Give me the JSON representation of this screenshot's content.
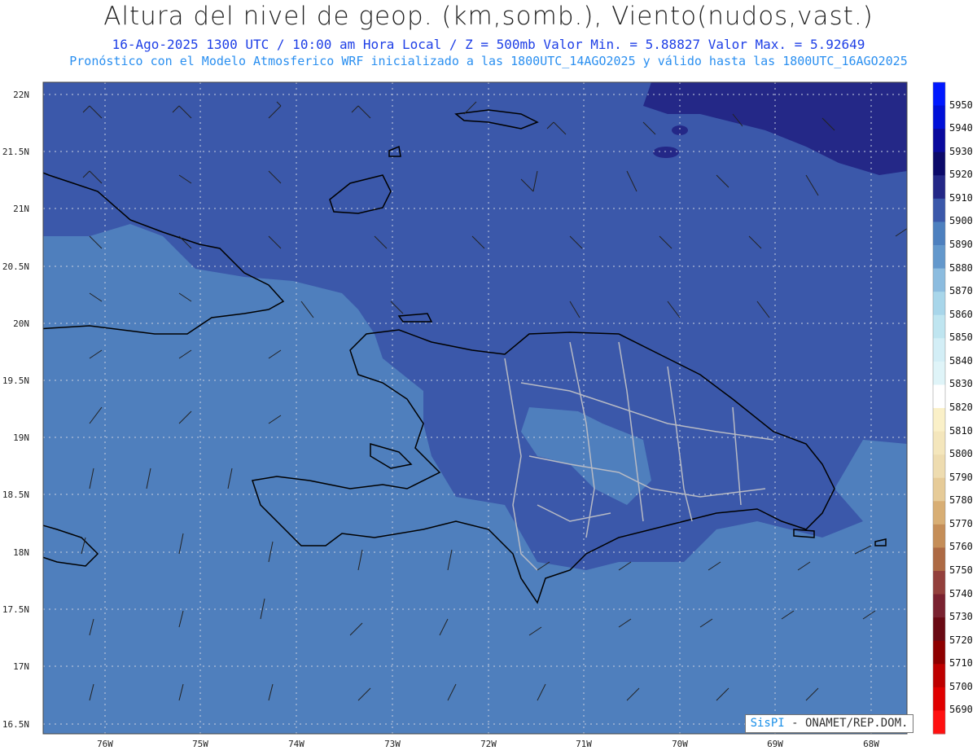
{
  "header": {
    "title": "Altura del nivel de geop. (km,somb.), Viento(nudos,vast.)",
    "subtitle": "16-Ago-2025  1300 UTC / 10:00 am Hora Local / Z = 500mb    Valor Min. = 5.88827  Valor Max. = 5.92649",
    "forecast_note": "Pronóstico con el Modelo Atmosferico WRF inicializado a las 1800UTC_14AGO2025 y válido hasta las  1800UTC_16AGO2025"
  },
  "axes": {
    "lat_labels": [
      "22N",
      "21.5N",
      "21N",
      "20.5N",
      "20N",
      "19.5N",
      "19N",
      "18.5N",
      "18N",
      "17.5N",
      "17N",
      "16.5N"
    ],
    "lon_labels": [
      "76W",
      "75W",
      "74W",
      "73W",
      "72W",
      "71W",
      "70W",
      "69W",
      "68W"
    ]
  },
  "colorbar": {
    "levels": [
      "5950",
      "5940",
      "5930",
      "5920",
      "5910",
      "5900",
      "5890",
      "5880",
      "5870",
      "5860",
      "5850",
      "5840",
      "5830",
      "5820",
      "5810",
      "5800",
      "5790",
      "5780",
      "5770",
      "5760",
      "5750",
      "5740",
      "5730",
      "5720",
      "5710",
      "5700",
      "5690"
    ],
    "colors": [
      "#0018ff",
      "#0010d8",
      "#0a0a9e",
      "#0c0a6a",
      "#242887",
      "#3b58aa",
      "#4d80bf",
      "#6398cc",
      "#8cbcdf",
      "#a8d6ea",
      "#bfe5f0",
      "#d3eef6",
      "#dff4f8",
      "#ffffff",
      "#faf0c8",
      "#f4e6bc",
      "#eedcb0",
      "#e6cb98",
      "#d8ae74",
      "#c58e58",
      "#ad6a44",
      "#93403c",
      "#7a2230",
      "#6a0a14",
      "#8e0000",
      "#be0000",
      "#e00000",
      "#ff1010"
    ]
  },
  "map": {
    "fill_colors": {
      "ocean_base": "#4f7fbd",
      "mid": "#3b58aa",
      "high": "#242887"
    }
  },
  "credit": {
    "brand": "SisPI",
    "suffix": " - ONAMET/REP.DOM."
  }
}
